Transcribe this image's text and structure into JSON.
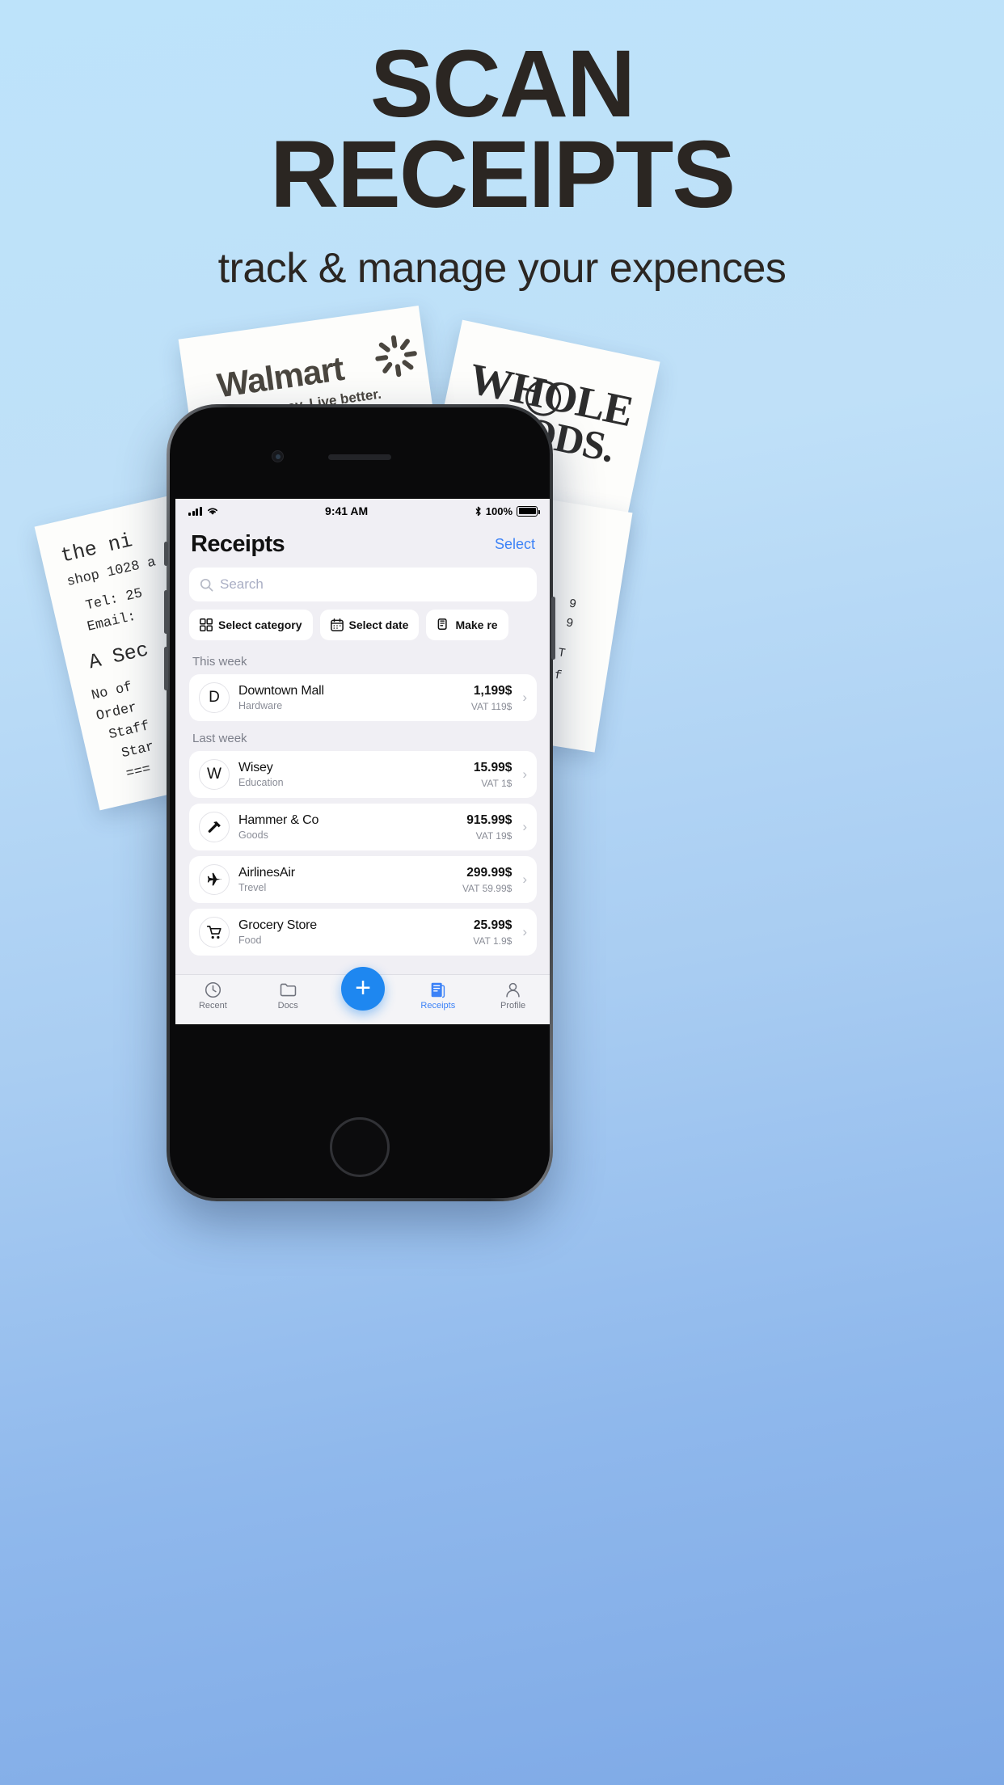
{
  "marketing": {
    "headline_line1": "SCAN",
    "headline_line2": "RECEIPTS",
    "subtitle": "track & manage your expences",
    "background_top": "#bde3fa",
    "background_bottom": "#7ea9e6",
    "text_color": "#2b2622"
  },
  "receipt_papers": {
    "walmart": {
      "logo": "Walmart",
      "tagline": "Save money. Live better.",
      "icon": "walmart-spark-icon"
    },
    "whole_foods": {
      "line1": "WHOLE",
      "line2": "FOODS."
    },
    "left_receipt": {
      "line1": "the ni",
      "line2": "shop 1028 a",
      "line3": "Tel: 25",
      "line4": "Email:",
      "line5": "A Sec",
      "line6": "No of",
      "line7": "Order",
      "line8": "Staff",
      "line9": "Star",
      "line10": "==="
    },
    "right_receipt": {
      "line1": "9",
      "line2": "9",
      "line3": "T",
      "line4": "f"
    }
  },
  "phone": {
    "status_bar": {
      "signal_icon": "cellular-bars-icon",
      "wifi_icon": "wifi-icon",
      "time": "9:41 AM",
      "bluetooth_icon": "bluetooth-icon",
      "battery_percent": "100%",
      "battery_icon": "battery-full-icon"
    },
    "header": {
      "title": "Receipts",
      "action_label": "Select",
      "action_color": "#3c82f7"
    },
    "search": {
      "placeholder": "Search",
      "icon": "search-icon"
    },
    "chips": [
      {
        "label": "Select category",
        "icon": "grid-icon"
      },
      {
        "label": "Select date",
        "icon": "calendar-icon"
      },
      {
        "label": "Make re",
        "icon": "document-icon"
      }
    ],
    "groups": [
      {
        "label": "This week",
        "rows": [
          {
            "avatar": "D",
            "avatar_kind": "letter",
            "name": "Downtown Mall",
            "category": "Hardware",
            "amount": "1,199$",
            "vat": "VAT 119$",
            "chevron": "chevron-right-icon"
          }
        ]
      },
      {
        "label": "Last week",
        "rows": [
          {
            "avatar": "W",
            "avatar_kind": "letter",
            "name": "Wisey",
            "category": "Education",
            "amount": "15.99$",
            "vat": "VAT 1$",
            "chevron": "chevron-right-icon"
          },
          {
            "avatar": "hammer-icon",
            "avatar_kind": "icon",
            "name": "Hammer & Co",
            "category": "Goods",
            "amount": "915.99$",
            "vat": "VAT 19$",
            "chevron": "chevron-right-icon"
          },
          {
            "avatar": "airplane-icon",
            "avatar_kind": "icon",
            "name": "AirlinesAir",
            "category": "Trevel",
            "amount": "299.99$",
            "vat": "VAT 59.99$",
            "chevron": "chevron-right-icon"
          },
          {
            "avatar": "cart-icon",
            "avatar_kind": "icon",
            "name": "Grocery Store",
            "category": "Food",
            "amount": "25.99$",
            "vat": "VAT 1.9$",
            "chevron": "chevron-right-icon"
          }
        ]
      }
    ],
    "tabbar": {
      "tabs": [
        {
          "label": "Recent",
          "icon": "clock-icon",
          "active": false
        },
        {
          "label": "Docs",
          "icon": "folder-icon",
          "active": false
        },
        {
          "label": "Receipts",
          "icon": "receipt-icon",
          "active": true
        },
        {
          "label": "Profile",
          "icon": "person-icon",
          "active": false
        }
      ],
      "fab": {
        "icon": "plus-icon",
        "color": "#1e87f0"
      },
      "active_color": "#3c82f7",
      "inactive_color": "#6f727c"
    }
  }
}
